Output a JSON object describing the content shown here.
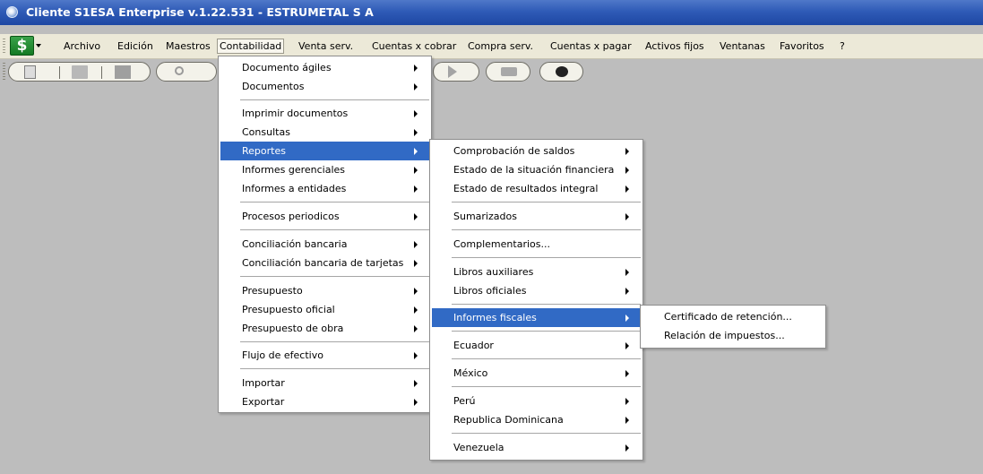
{
  "window": {
    "title": "Cliente S1ESA Enterprise v.1.22.531 - ESTRUMETAL S A"
  },
  "app_logo": "$",
  "menubar": {
    "items": [
      {
        "label": "Archivo"
      },
      {
        "label": "Edición"
      },
      {
        "label": "Maestros"
      },
      {
        "label": "Contabilidad",
        "active": true
      },
      {
        "label": "Venta serv."
      },
      {
        "label": "Cuentas x cobrar"
      },
      {
        "label": "Compra serv."
      },
      {
        "label": "Cuentas x pagar"
      },
      {
        "label": "Activos fijos"
      },
      {
        "label": "Ventanas"
      },
      {
        "label": "Favoritos"
      },
      {
        "label": "?"
      }
    ]
  },
  "toolbar": {
    "icons": [
      "new-document-icon",
      "open-folder-icon",
      "copy-icon",
      "search-icon",
      "next-arrow-icon",
      "print-icon",
      "chat-help-icon"
    ]
  },
  "contabilidad_menu": [
    {
      "label": "Documento ágiles",
      "submenu": true
    },
    {
      "label": "Documentos",
      "submenu": true
    },
    {
      "label": "Imprimir documentos",
      "submenu": true
    },
    {
      "label": "Consultas",
      "submenu": true
    },
    {
      "label": "Reportes",
      "submenu": true,
      "highlighted": true
    },
    {
      "label": "Informes gerenciales",
      "submenu": true
    },
    {
      "label": "Informes a entidades",
      "submenu": true
    },
    {
      "label": "Procesos periodicos",
      "submenu": true
    },
    {
      "label": "Conciliación bancaria",
      "submenu": true
    },
    {
      "label": "Conciliación bancaria de tarjetas",
      "submenu": true
    },
    {
      "label": "Presupuesto",
      "submenu": true
    },
    {
      "label": "Presupuesto oficial",
      "submenu": true
    },
    {
      "label": "Presupuesto de obra",
      "submenu": true
    },
    {
      "label": "Flujo de efectivo",
      "submenu": true
    },
    {
      "label": "Importar",
      "submenu": true
    },
    {
      "label": "Exportar",
      "submenu": true
    }
  ],
  "reportes_menu": [
    {
      "label": "Comprobación de saldos",
      "submenu": true
    },
    {
      "label": "Estado de la situación financiera",
      "submenu": true
    },
    {
      "label": "Estado de resultados integral",
      "submenu": true
    },
    {
      "label": "Sumarizados",
      "submenu": true
    },
    {
      "label": "Complementarios...",
      "submenu": false
    },
    {
      "label": "Libros auxiliares",
      "submenu": true
    },
    {
      "label": "Libros oficiales",
      "submenu": true
    },
    {
      "label": "Informes fiscales",
      "submenu": true,
      "highlighted": true
    },
    {
      "label": "Ecuador",
      "submenu": true
    },
    {
      "label": "México",
      "submenu": true
    },
    {
      "label": "Perú",
      "submenu": true
    },
    {
      "label": "Republica Dominicana",
      "submenu": true
    },
    {
      "label": "Venezuela",
      "submenu": true
    }
  ],
  "informes_fiscales_menu": [
    {
      "label": "Certificado de retención..."
    },
    {
      "label": "Relación de impuestos..."
    }
  ],
  "colors": {
    "titlebar": "#2f5bb7",
    "menubar": "#ece9d8",
    "desktop": "#bdbdbd",
    "highlight": "#316ac5"
  }
}
